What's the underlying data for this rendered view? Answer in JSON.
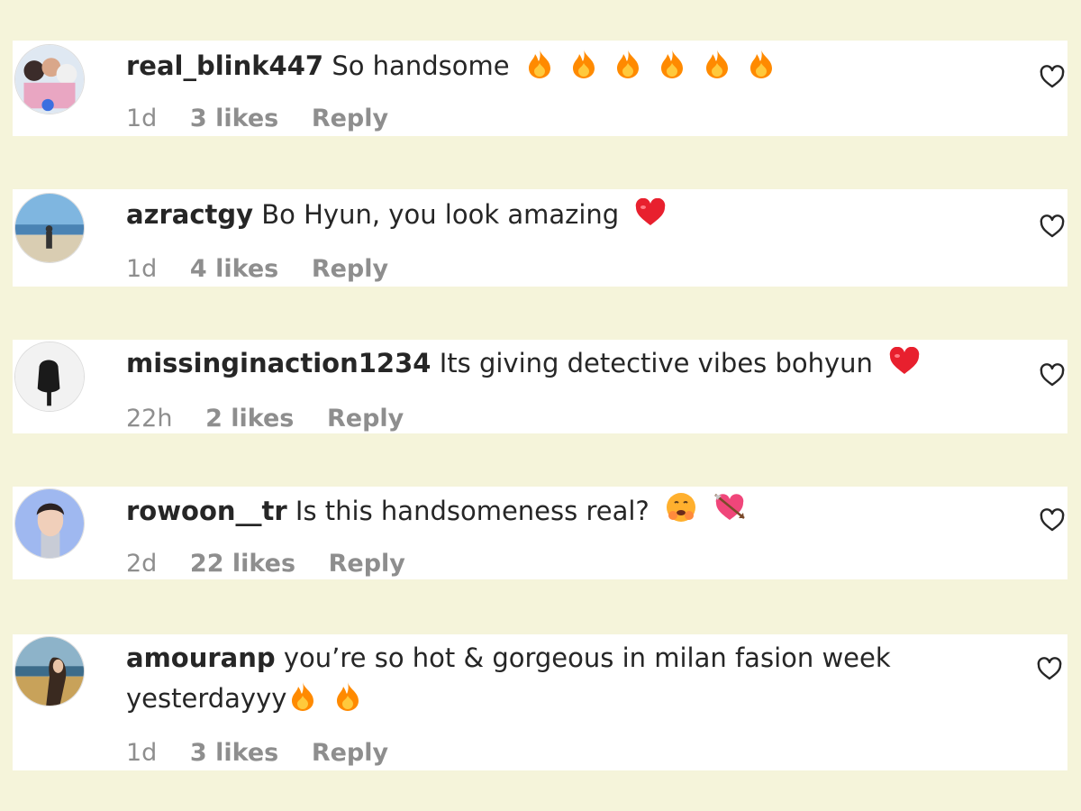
{
  "comments": [
    {
      "username": "real_blink447",
      "text": "So handsome",
      "emojis": [
        "fire-emoji",
        "fire-emoji",
        "fire-emoji",
        "fire-emoji",
        "fire-emoji",
        "fire-emoji"
      ],
      "age": "1d",
      "likes": "3 likes",
      "reply": "Reply"
    },
    {
      "username": "azractgy",
      "text": "Bo Hyun, you look amazing",
      "emojis": [
        "red-heart-emoji"
      ],
      "age": "1d",
      "likes": "4 likes",
      "reply": "Reply"
    },
    {
      "username": "missinginaction1234",
      "text": "Its giving detective vibes bohyun",
      "emojis": [
        "red-heart-emoji"
      ],
      "age": "22h",
      "likes": "2 likes",
      "reply": "Reply"
    },
    {
      "username": "rowoon__tr",
      "text": "Is this handsomeness real?",
      "emojis": [
        "hugging-face-emoji",
        "heart-with-arrow-emoji"
      ],
      "age": "2d",
      "likes": "22 likes",
      "reply": "Reply"
    },
    {
      "username": "amouranp",
      "text": "you’re so hot & gorgeous in milan fasion week",
      "text_line2": "yesterdayyy",
      "emojis": [
        "fire-emoji",
        "fire-emoji"
      ],
      "age": "1d",
      "likes": "3 likes",
      "reply": "Reply"
    }
  ],
  "icons": {
    "like": "heart-outline-icon"
  },
  "colors": {
    "page_background": "#f5f4da",
    "card_background": "#ffffff",
    "text": "#262626",
    "meta_text": "#8e8e8e",
    "fire": "#ff8a00",
    "heart_red": "#e8202e"
  }
}
